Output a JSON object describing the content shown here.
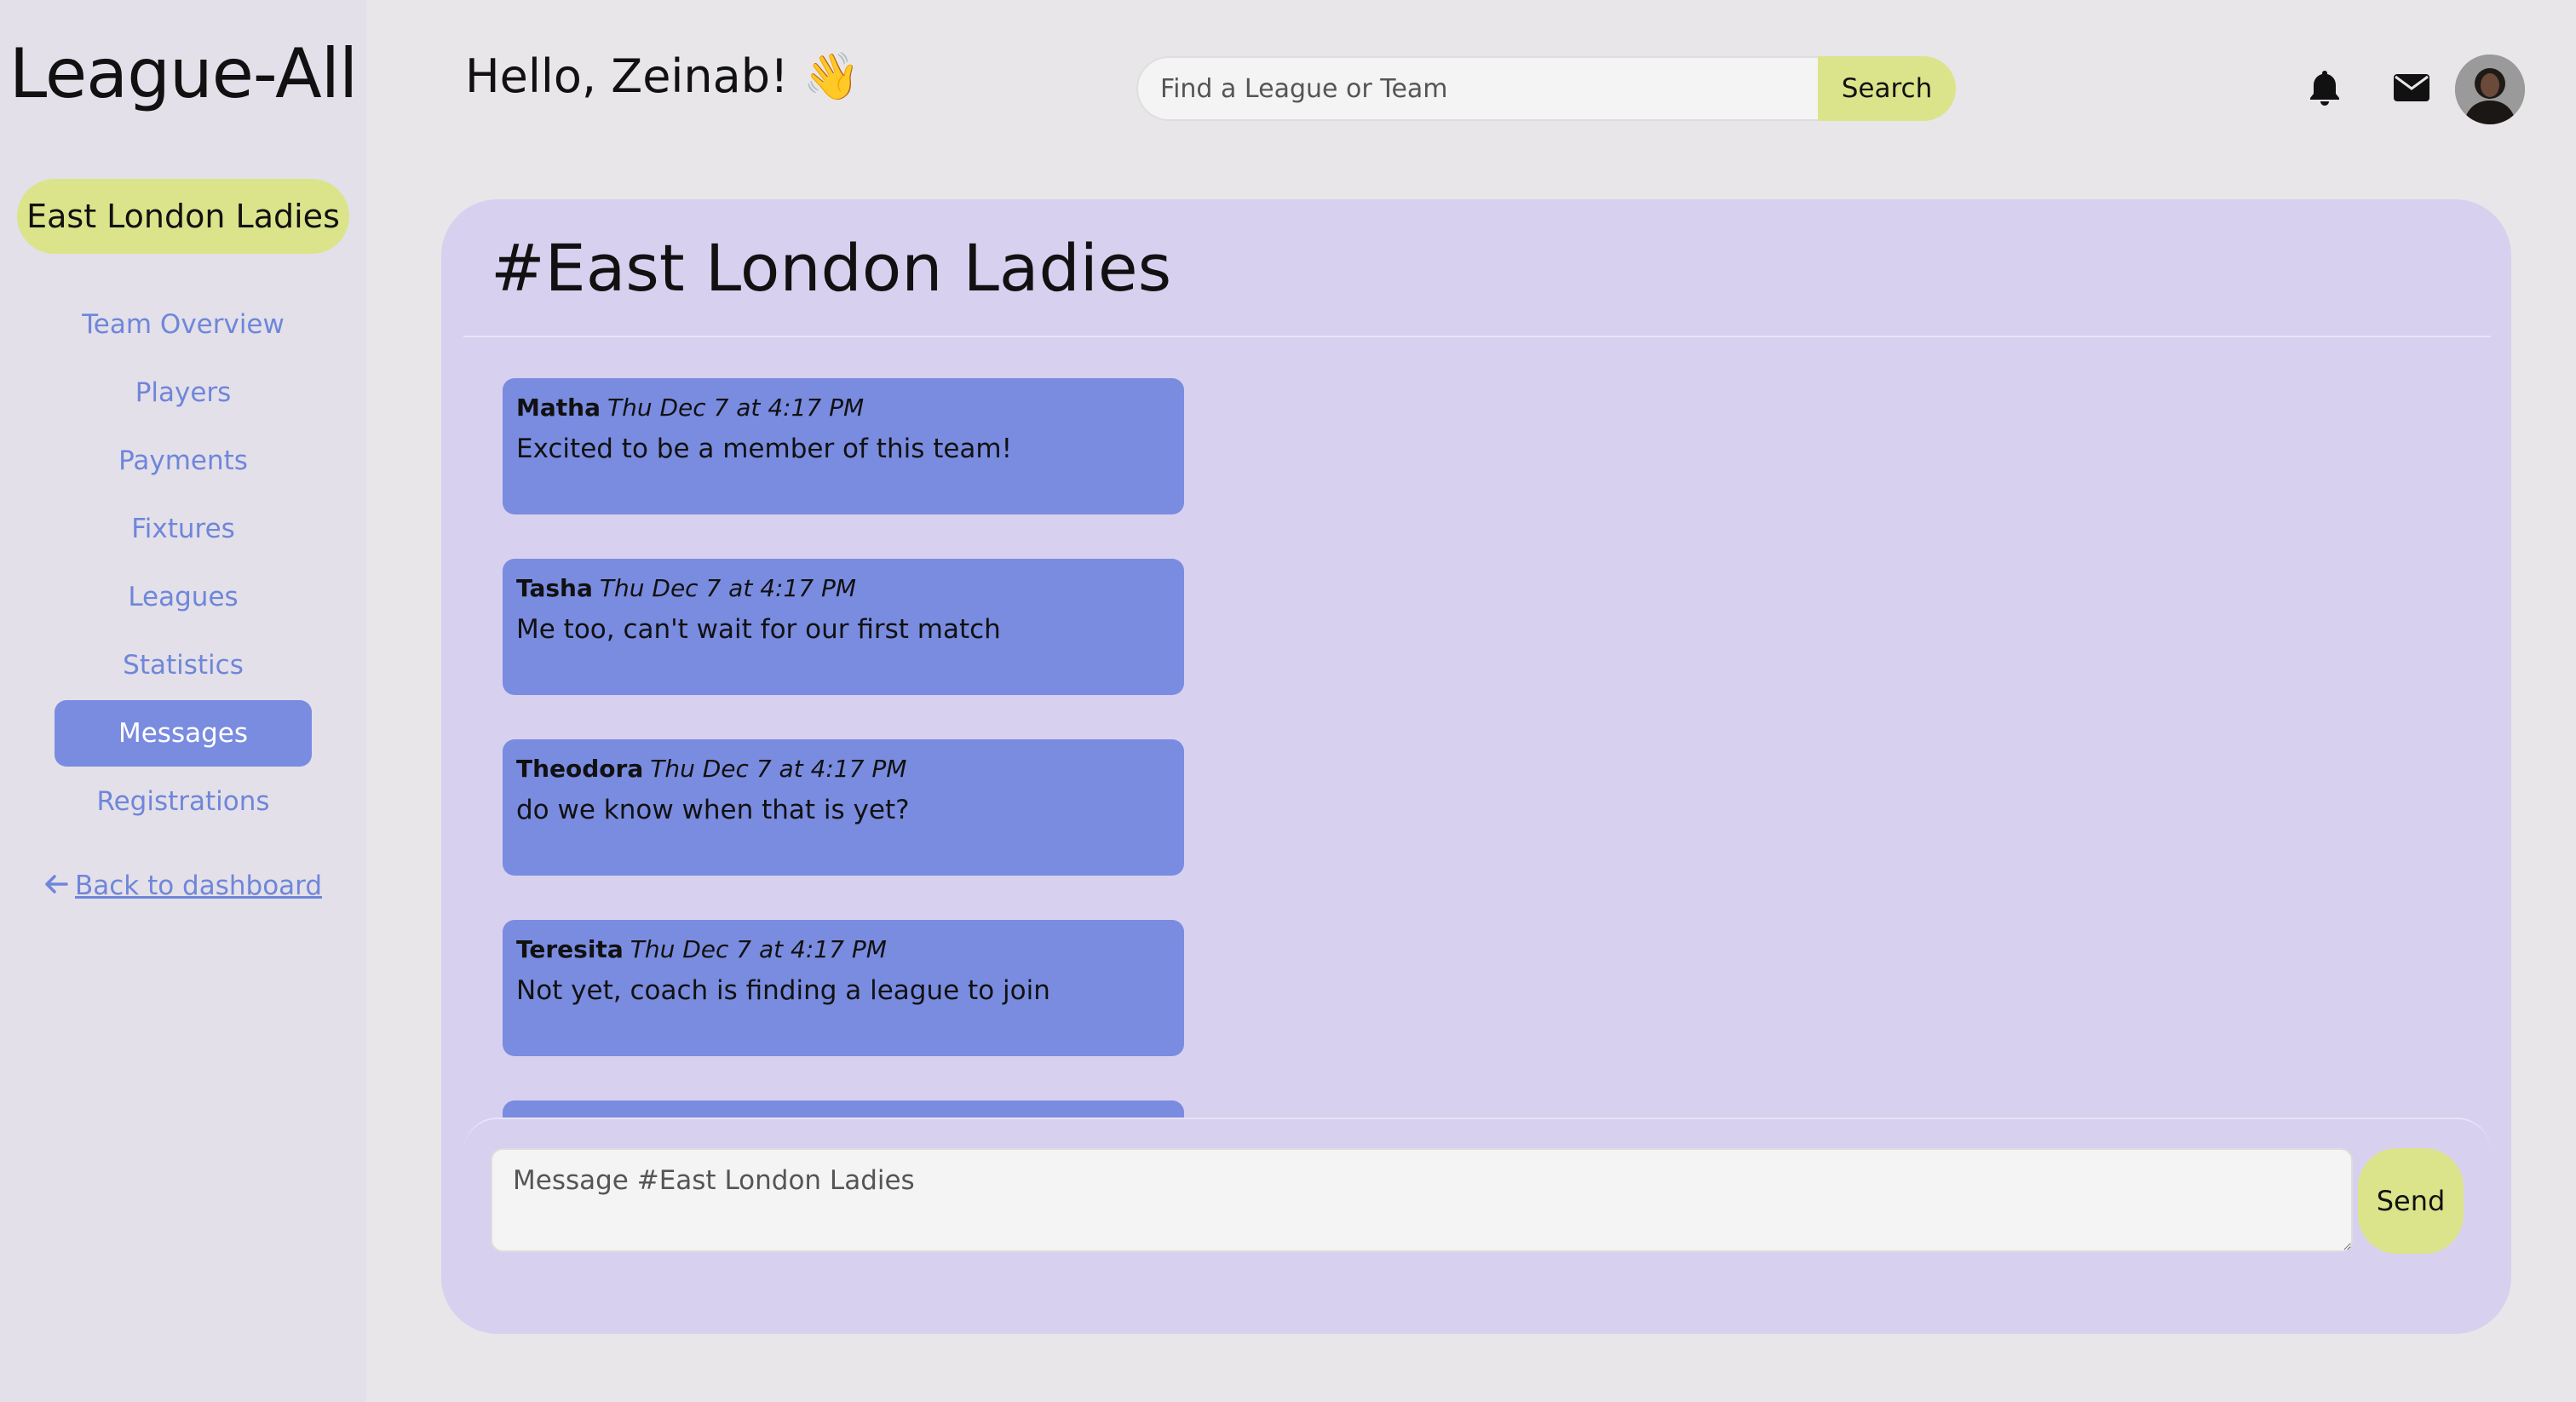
{
  "sidebar": {
    "logo": "League-All",
    "team_name": "East London Ladies",
    "nav": [
      {
        "label": "Team Overview",
        "active": false
      },
      {
        "label": "Players",
        "active": false
      },
      {
        "label": "Payments",
        "active": false
      },
      {
        "label": "Fixtures",
        "active": false
      },
      {
        "label": "Leagues",
        "active": false
      },
      {
        "label": "Statistics",
        "active": false
      },
      {
        "label": "Messages",
        "active": true
      },
      {
        "label": "Registrations",
        "active": false
      }
    ],
    "back_link": "Back to dashboard",
    "back_icon": "arrow-left-icon"
  },
  "header": {
    "greeting": "Hello, Zeinab! 👋",
    "search": {
      "placeholder": "Find a League or Team",
      "button": "Search"
    },
    "icons": [
      "bell-icon",
      "envelope-icon"
    ],
    "avatar": "user-avatar"
  },
  "chat": {
    "title": "#East London Ladies",
    "messages": [
      {
        "author": "Matha",
        "time": "Thu Dec 7 at 4:17 PM",
        "text": "Excited to be a member of this team!"
      },
      {
        "author": "Tasha",
        "time": "Thu Dec 7 at 4:17 PM",
        "text": "Me too, can't wait for our first match"
      },
      {
        "author": "Theodora",
        "time": "Thu Dec 7 at 4:17 PM",
        "text": "do we know when that is yet?"
      },
      {
        "author": "Teresita",
        "time": "Thu Dec 7 at 4:17 PM",
        "text": "Not yet, coach is finding a league to join"
      }
    ],
    "composer": {
      "placeholder": "Message #East London Ladies",
      "send": "Send"
    }
  },
  "colors": {
    "background": "#e8e6e9",
    "sidebar": "#e3e0ea",
    "panel": "#d8d0ef",
    "accent_lime": "#dbe48a",
    "accent_blue": "#7a8ce0",
    "link": "#6f86d9"
  }
}
